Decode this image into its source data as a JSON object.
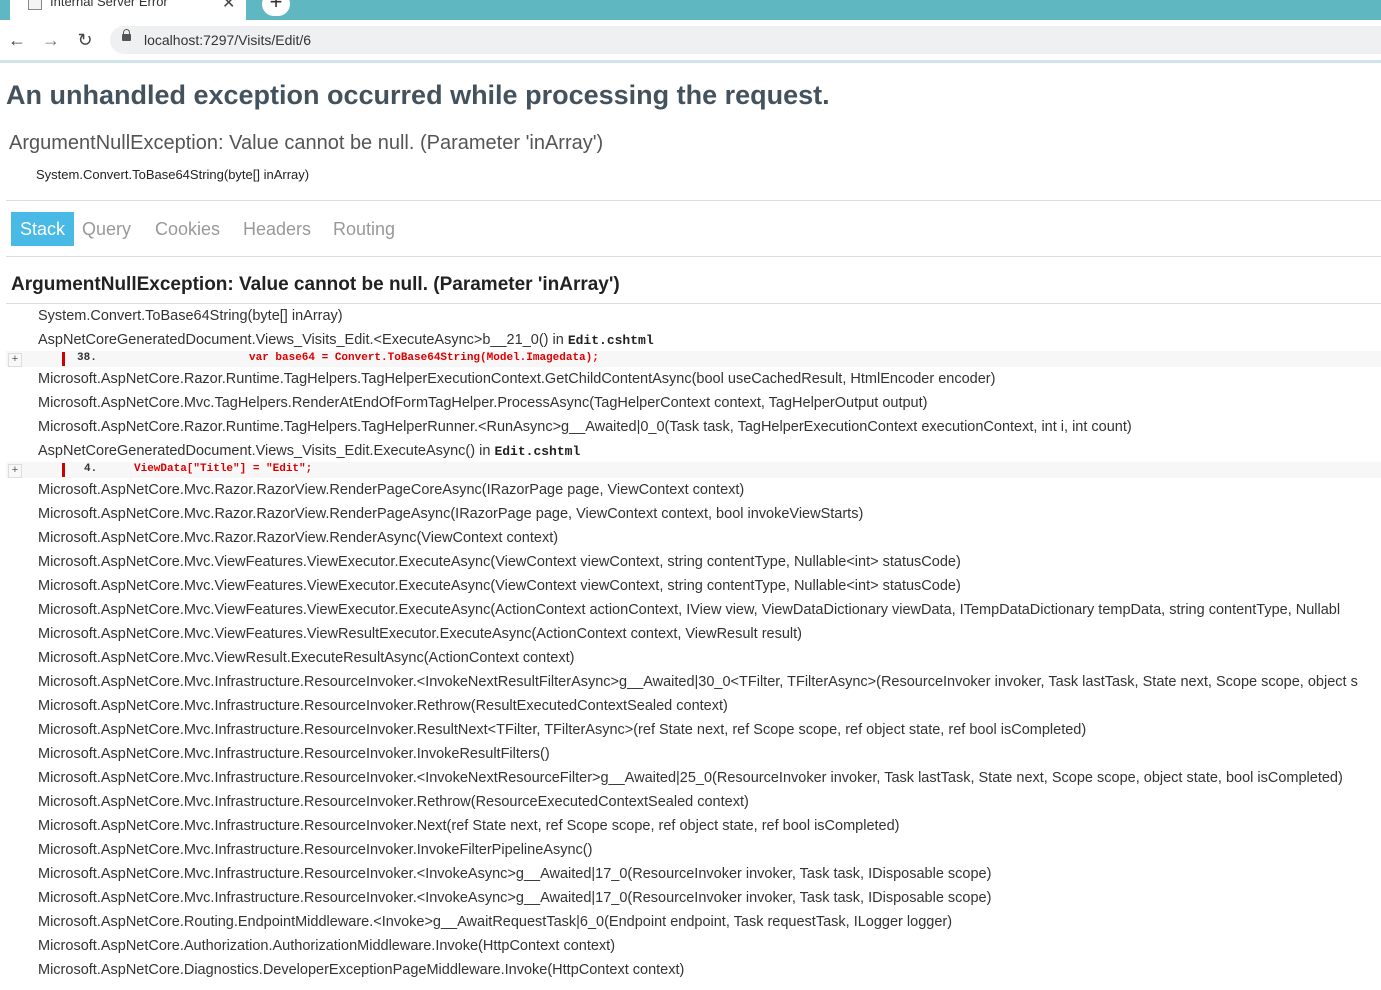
{
  "browser": {
    "tab_title": "Internal Server Error",
    "tab_close": "✕",
    "new_tab": "+",
    "url": "localhost:7297/Visits/Edit/6",
    "icons": {
      "back": "arrow-left-icon",
      "forward": "arrow-right-icon",
      "reload": "reload-icon",
      "lock": "lock-icon"
    }
  },
  "page": {
    "heading": "An unhandled exception occurred while processing the request.",
    "title_error": "ArgumentNullException: Value cannot be null. (Parameter 'inArray')",
    "location": "System.Convert.ToBase64String(byte[] inArray)",
    "tabs": [
      "Stack",
      "Query",
      "Cookies",
      "Headers",
      "Routing"
    ],
    "active_tab": "Stack",
    "stack_heading": "ArgumentNullException: Value cannot be null. (Parameter 'inArray')",
    "frames": [
      {
        "text": "System.Convert.ToBase64String(byte[] inArray)"
      },
      {
        "text": "AspNetCoreGeneratedDocument.Views_Visits_Edit.<ExecuteAsync>b__21_0() in ",
        "file": "Edit.cshtml",
        "code": {
          "expander": "+",
          "line": "38.",
          "source": "var base64 = Convert.ToBase64String(Model.Imagedata);"
        }
      },
      {
        "text": "Microsoft.AspNetCore.Razor.Runtime.TagHelpers.TagHelperExecutionContext.GetChildContentAsync(bool useCachedResult, HtmlEncoder encoder)"
      },
      {
        "text": "Microsoft.AspNetCore.Mvc.TagHelpers.RenderAtEndOfFormTagHelper.ProcessAsync(TagHelperContext context, TagHelperOutput output)"
      },
      {
        "text": "Microsoft.AspNetCore.Razor.Runtime.TagHelpers.TagHelperRunner.<RunAsync>g__Awaited|0_0(Task task, TagHelperExecutionContext executionContext, int i, int count)"
      },
      {
        "text": "AspNetCoreGeneratedDocument.Views_Visits_Edit.ExecuteAsync() in ",
        "file": "Edit.cshtml",
        "code": {
          "expander": "+",
          "line": "4.",
          "source": "ViewData[\"Title\"] = \"Edit\";"
        }
      },
      {
        "text": "Microsoft.AspNetCore.Mvc.Razor.RazorView.RenderPageCoreAsync(IRazorPage page, ViewContext context)"
      },
      {
        "text": "Microsoft.AspNetCore.Mvc.Razor.RazorView.RenderPageAsync(IRazorPage page, ViewContext context, bool invokeViewStarts)"
      },
      {
        "text": "Microsoft.AspNetCore.Mvc.Razor.RazorView.RenderAsync(ViewContext context)"
      },
      {
        "text": "Microsoft.AspNetCore.Mvc.ViewFeatures.ViewExecutor.ExecuteAsync(ViewContext viewContext, string contentType, Nullable<int> statusCode)"
      },
      {
        "text": "Microsoft.AspNetCore.Mvc.ViewFeatures.ViewExecutor.ExecuteAsync(ViewContext viewContext, string contentType, Nullable<int> statusCode)"
      },
      {
        "text": "Microsoft.AspNetCore.Mvc.ViewFeatures.ViewExecutor.ExecuteAsync(ActionContext actionContext, IView view, ViewDataDictionary viewData, ITempDataDictionary tempData, string contentType, Nullabl"
      },
      {
        "text": "Microsoft.AspNetCore.Mvc.ViewFeatures.ViewResultExecutor.ExecuteAsync(ActionContext context, ViewResult result)"
      },
      {
        "text": "Microsoft.AspNetCore.Mvc.ViewResult.ExecuteResultAsync(ActionContext context)"
      },
      {
        "text": "Microsoft.AspNetCore.Mvc.Infrastructure.ResourceInvoker.<InvokeNextResultFilterAsync>g__Awaited|30_0<TFilter, TFilterAsync>(ResourceInvoker invoker, Task lastTask, State next, Scope scope, object s"
      },
      {
        "text": "Microsoft.AspNetCore.Mvc.Infrastructure.ResourceInvoker.Rethrow(ResultExecutedContextSealed context)"
      },
      {
        "text": "Microsoft.AspNetCore.Mvc.Infrastructure.ResourceInvoker.ResultNext<TFilter, TFilterAsync>(ref State next, ref Scope scope, ref object state, ref bool isCompleted)"
      },
      {
        "text": "Microsoft.AspNetCore.Mvc.Infrastructure.ResourceInvoker.InvokeResultFilters()"
      },
      {
        "text": "Microsoft.AspNetCore.Mvc.Infrastructure.ResourceInvoker.<InvokeNextResourceFilter>g__Awaited|25_0(ResourceInvoker invoker, Task lastTask, State next, Scope scope, object state, bool isCompleted)"
      },
      {
        "text": "Microsoft.AspNetCore.Mvc.Infrastructure.ResourceInvoker.Rethrow(ResourceExecutedContextSealed context)"
      },
      {
        "text": "Microsoft.AspNetCore.Mvc.Infrastructure.ResourceInvoker.Next(ref State next, ref Scope scope, ref object state, ref bool isCompleted)"
      },
      {
        "text": "Microsoft.AspNetCore.Mvc.Infrastructure.ResourceInvoker.InvokeFilterPipelineAsync()"
      },
      {
        "text": "Microsoft.AspNetCore.Mvc.Infrastructure.ResourceInvoker.<InvokeAsync>g__Awaited|17_0(ResourceInvoker invoker, Task task, IDisposable scope)"
      },
      {
        "text": "Microsoft.AspNetCore.Mvc.Infrastructure.ResourceInvoker.<InvokeAsync>g__Awaited|17_0(ResourceInvoker invoker, Task task, IDisposable scope)"
      },
      {
        "text": "Microsoft.AspNetCore.Routing.EndpointMiddleware.<Invoke>g__AwaitRequestTask|6_0(Endpoint endpoint, Task requestTask, ILogger logger)"
      },
      {
        "text": "Microsoft.AspNetCore.Authorization.AuthorizationMiddleware.Invoke(HttpContext context)"
      },
      {
        "text": "Microsoft.AspNetCore.Diagnostics.DeveloperExceptionPageMiddleware.Invoke(HttpContext context)"
      }
    ]
  },
  "colors": {
    "tabbar": "#5fb8c1",
    "active_tab": "#49b9e6",
    "heading": "#44525e",
    "code_error": "#dd0000"
  }
}
